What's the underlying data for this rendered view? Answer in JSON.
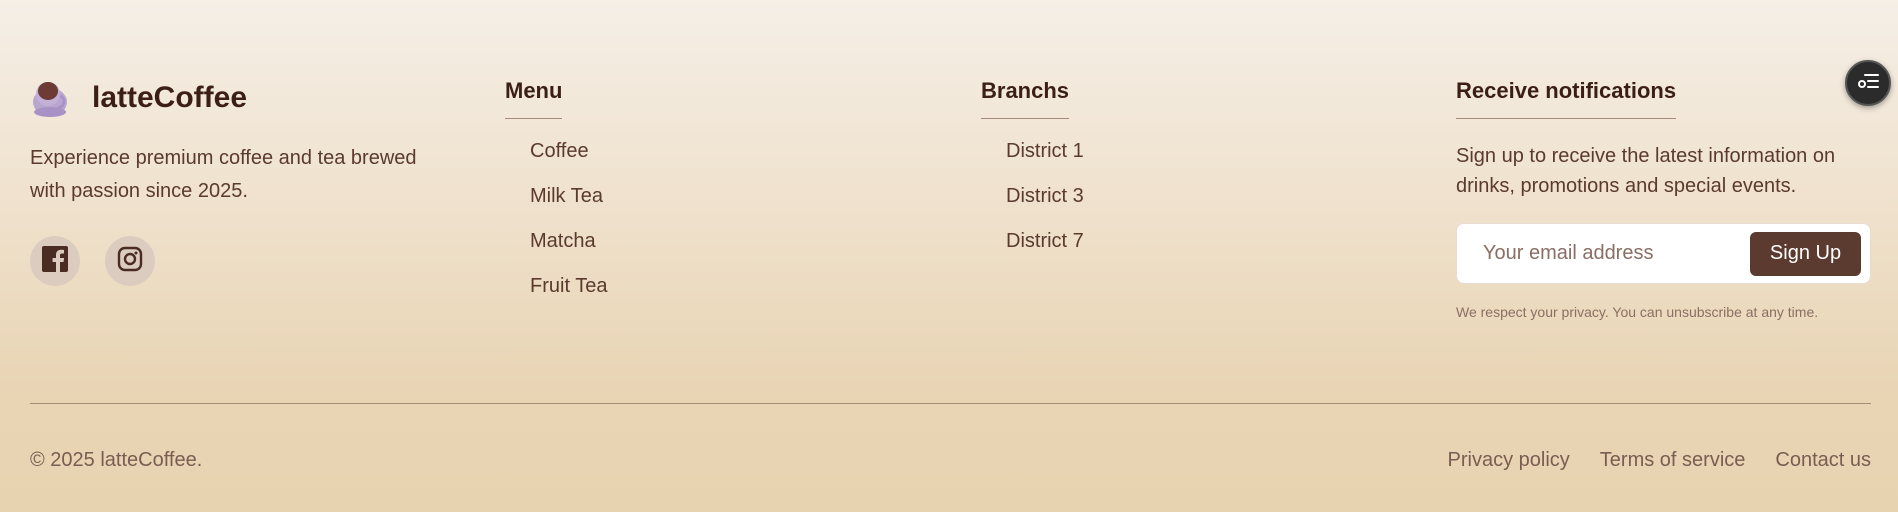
{
  "brand": {
    "name": "latteCoffee",
    "description_line1": "Experience premium coffee and tea brewed",
    "description_line2": "with passion since 2025.",
    "logo_icon": "coffee-cup-icon",
    "socials": [
      {
        "icon": "facebook-icon"
      },
      {
        "icon": "instagram-icon"
      }
    ]
  },
  "menu": {
    "title": "Menu",
    "items": [
      "Coffee",
      "Milk Tea",
      "Matcha",
      "Fruit Tea"
    ]
  },
  "branches": {
    "title": "Branchs",
    "items": [
      "District 1",
      "District 3",
      "District 7"
    ]
  },
  "notifications": {
    "title": "Receive notifications",
    "text_line1": "Sign up to receive the latest information on",
    "text_line2": "drinks, promotions and special events.",
    "email_placeholder": "Your email address",
    "signup_label": "Sign Up",
    "privacy_note": "We respect your privacy. You can unsubscribe at any time."
  },
  "bottom": {
    "copyright": "© 2025 latteCoffee.",
    "links": [
      "Privacy policy",
      "Terms of service",
      "Contact us"
    ]
  },
  "floating_button": {
    "icon": "settings-list-icon"
  },
  "colors": {
    "accent": "#5b3a2f",
    "text_dark": "#3b1f16",
    "text_muted": "#7a5d52",
    "bg_top": "#f5efe7",
    "bg_bottom": "#e8d3b0"
  }
}
